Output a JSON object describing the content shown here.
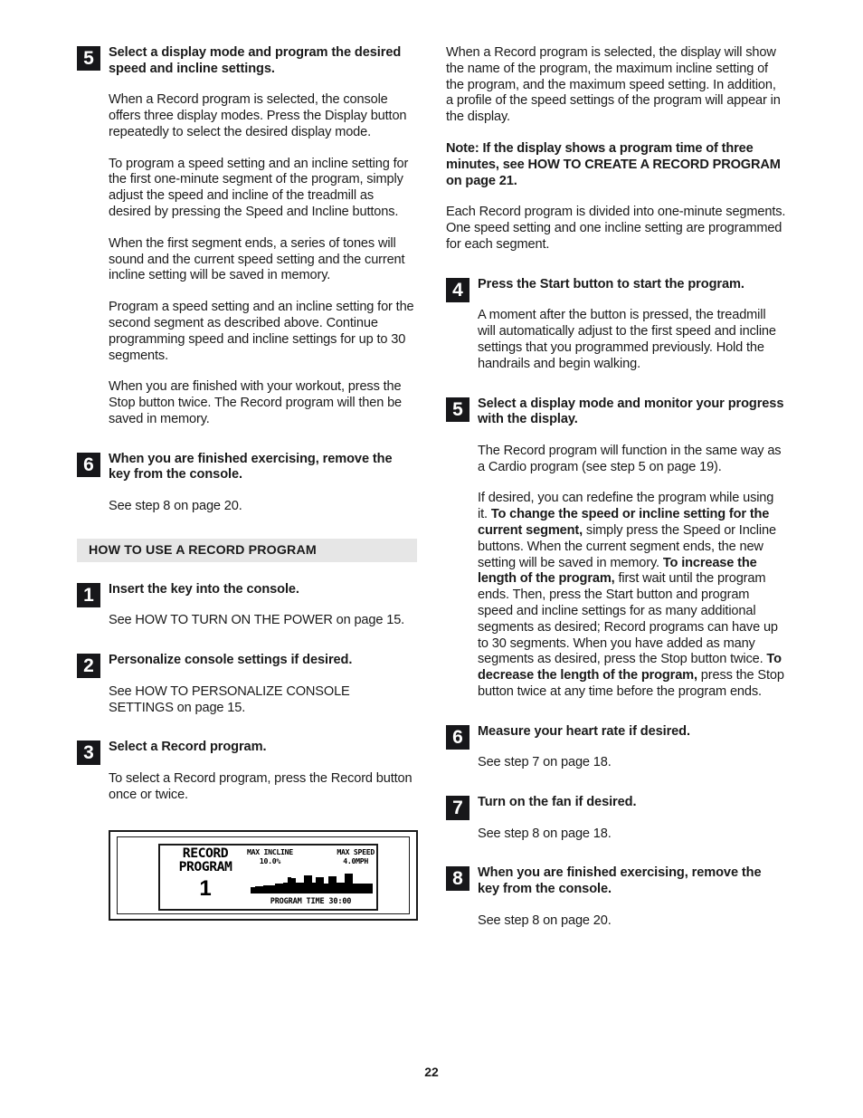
{
  "page": {
    "number": "22",
    "section_heading": "HOW TO USE A RECORD PROGRAM"
  },
  "left_column": {
    "step5": {
      "badge": "5",
      "title": "Select a display mode and program the desired speed and incline settings.",
      "p1": "When a Record program is selected, the console offers three display modes. Press the Display button repeatedly to select the desired display mode.",
      "p2": "To program a speed setting and an incline setting for the first one-minute segment of the program, simply adjust the speed and incline of the treadmill as desired by pressing the Speed and Incline buttons.",
      "p3": "When the first segment ends, a series of tones will sound and the current speed setting and the current incline setting will be saved in memory.",
      "p4": "Program a speed setting and an incline setting for the second segment as described above. Continue programming speed and incline settings for up to 30 segments.",
      "p5": "When you are finished with your workout, press the Stop button twice. The Record program will then be saved in memory."
    },
    "step6": {
      "badge": "6",
      "title": "When you are finished exercising, remove the key from the console.",
      "p1": "See step 8 on page 20."
    },
    "step1": {
      "badge": "1",
      "title": "Insert the key into the console.",
      "p1": "See HOW TO TURN ON THE POWER on page 15."
    },
    "step2": {
      "badge": "2",
      "title": "Personalize console settings if desired.",
      "p1": "See HOW TO PERSONALIZE CONSOLE SETTINGS on page 15."
    },
    "step3": {
      "badge": "3",
      "title": "Select a Record program.",
      "p1": "To select a Record program, press the Record button once or twice."
    }
  },
  "console_display": {
    "title_line1": "RECORD",
    "title_line2": "PROGRAM",
    "program_number": "1",
    "max_incline_label": "MAX INCLINE",
    "max_incline_value": "10.0%",
    "max_speed_label": "MAX SPEED",
    "max_speed_value": "4.0MPH",
    "program_time": "PROGRAM TIME  30:00",
    "profile_heights": [
      6,
      7,
      7,
      8,
      8,
      8,
      9,
      9,
      10,
      15,
      14,
      10,
      10,
      17,
      17,
      10,
      15,
      15,
      9,
      16,
      16,
      10,
      10,
      18,
      18,
      9,
      9,
      9,
      9,
      9
    ]
  },
  "right_column": {
    "top_text": {
      "p1": "When a Record program is selected, the display will show the name of the program, the maximum incline setting of the program, and the maximum speed setting. In addition, a profile of the speed settings of the program will appear in the display.",
      "note": "Note: If the display shows a program time of three minutes, see HOW TO CREATE A RECORD PROGRAM on page 21.",
      "p2": "Each Record program is divided into one-minute segments. One speed setting and one incline setting are programmed for each segment."
    },
    "step4": {
      "badge": "4",
      "title": "Press the Start button to start the program.",
      "p1": "A moment after the button is pressed, the treadmill will automatically adjust to the first speed and incline settings that you programmed previously. Hold the handrails and begin walking."
    },
    "step5": {
      "badge": "5",
      "title": "Select a display mode and monitor your progress with the display.",
      "p1": "The Record program will function in the same way as a Cardio program (see step 5 on page 19).",
      "p2_seg1": "If desired, you can redefine the program while using it. ",
      "p2_bold1": "To change the speed or incline setting for the current segment,",
      "p2_seg2": " simply press the Speed or Incline buttons. When the current segment ends, the new setting will be saved in memory. ",
      "p2_bold2": "To increase the length of the program,",
      "p2_seg3": " first wait until the program ends. Then, press the Start button and program speed and incline settings for as many additional segments as desired; Record programs can have up to 30 segments. When you have added as many segments as desired, press the Stop button twice. ",
      "p2_bold3": "To decrease the length of the program,",
      "p2_seg4": " press the Stop button twice at any time before the program ends."
    },
    "step6": {
      "badge": "6",
      "title": "Measure your heart rate if desired.",
      "p1": "See step 7 on page 18."
    },
    "step7": {
      "badge": "7",
      "title": "Turn on the fan if desired.",
      "p1": "See step 8 on page 18."
    },
    "step8": {
      "badge": "8",
      "title": "When you are finished exercising, remove the key from the console.",
      "p1": "See step 8 on page 20."
    }
  }
}
